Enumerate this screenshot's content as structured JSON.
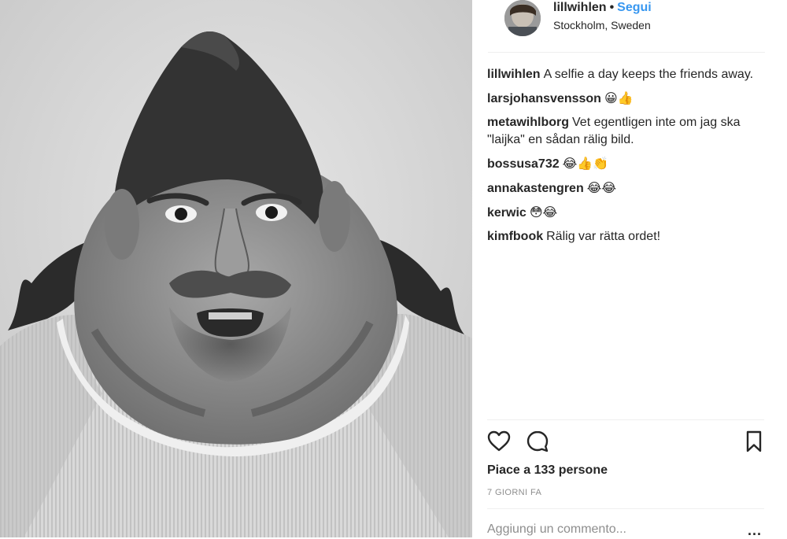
{
  "post": {
    "username": "lillwihlen",
    "separator": "•",
    "follow_label": "Segui",
    "location": "Stockholm, Sweden"
  },
  "comments": [
    {
      "user": "lillwihlen",
      "text": "A selfie a day keeps the friends away."
    },
    {
      "user": "larsjohansvensson",
      "text": "😀👍"
    },
    {
      "user": "metawihlborg",
      "text": "Vet egentligen inte om jag ska \"laijka\" en sådan rälig bild."
    },
    {
      "user": "bossusa732",
      "text": "😂👍👏"
    },
    {
      "user": "annakastengren",
      "text": "😂😂"
    },
    {
      "user": "kerwic",
      "text": "😳😂"
    },
    {
      "user": "kimfbook",
      "text": "Rälig var rätta ordet!"
    }
  ],
  "actions": {
    "like_icon": "heart-icon",
    "comment_icon": "comment-bubble-icon",
    "save_icon": "bookmark-icon"
  },
  "likes_text": "Piace a 133 persone",
  "time_text": "7 GIORNI FA",
  "add_comment_placeholder": "Aggiungi un commento...",
  "more_label": "...",
  "colors": {
    "link": "#3897f0",
    "muted": "#8e8e8e",
    "divider": "#efefef"
  }
}
